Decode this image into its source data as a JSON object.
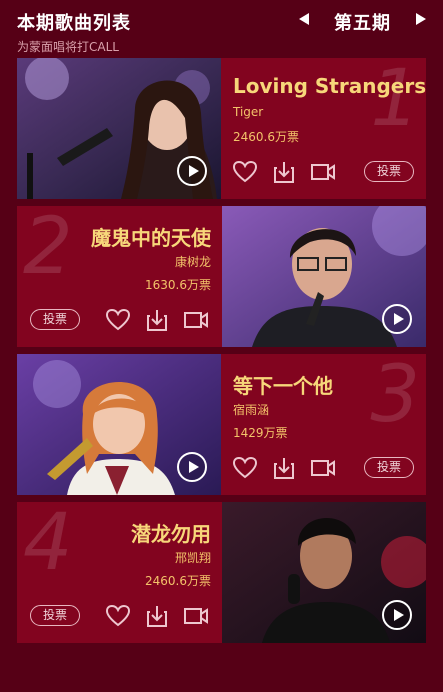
{
  "header": {
    "title": "本期歌曲列表",
    "subtitle": "为蒙面唱将打CALL",
    "period": "第五期",
    "prev_icon": "triangle-left",
    "next_icon": "triangle-right"
  },
  "songs": [
    {
      "rank": "1",
      "title": "Loving Strangers",
      "singer": "Tiger",
      "votes": "2460.6万票",
      "vote_label": "投票"
    },
    {
      "rank": "2",
      "title": "魔鬼中的天使",
      "singer": "康树龙",
      "votes": "1630.6万票",
      "vote_label": "投票"
    },
    {
      "rank": "3",
      "title": "等下一个他",
      "singer": "宿雨涵",
      "votes": "1429万票",
      "vote_label": "投票"
    },
    {
      "rank": "4",
      "title": "潜龙勿用",
      "singer": "邢凯翔",
      "votes": "2460.6万票",
      "vote_label": "投票"
    }
  ],
  "colors": {
    "background": "#560016",
    "card": "#82041f",
    "song_title": "#f7d77a",
    "meta": "#f3c36a"
  },
  "icons": [
    "heart-icon",
    "download-icon",
    "video-icon",
    "play-icon"
  ]
}
